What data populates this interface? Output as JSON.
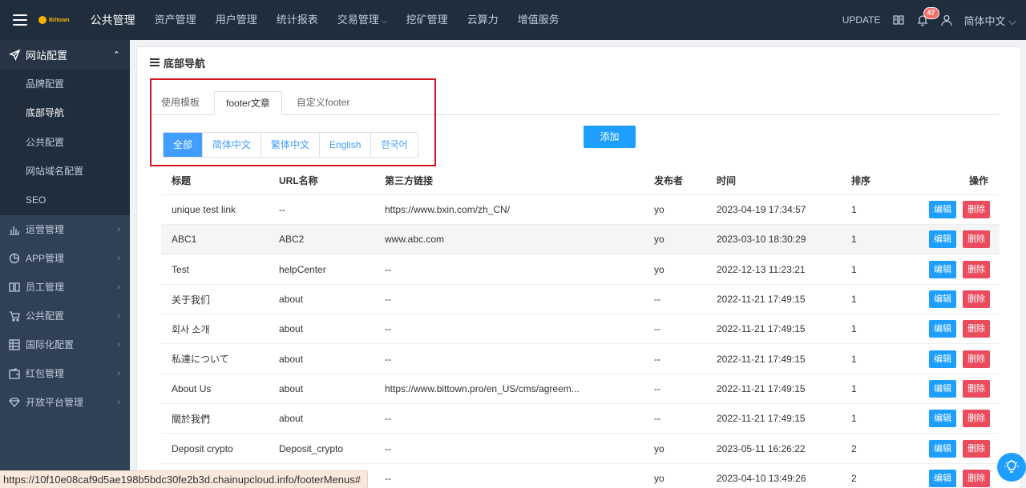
{
  "topbar": {
    "logo_text": "Bittown",
    "nav": [
      {
        "label": "公共管理",
        "active": true
      },
      {
        "label": "资产管理"
      },
      {
        "label": "用户管理"
      },
      {
        "label": "统计报表"
      },
      {
        "label": "交易管理",
        "has_dropdown": true
      },
      {
        "label": "挖矿管理"
      },
      {
        "label": "云算力"
      },
      {
        "label": "增值服务"
      }
    ],
    "update_label": "UPDATE",
    "notification_count": "47",
    "language": "简体中文"
  },
  "sidebar": {
    "open_group": {
      "label": "网站配置",
      "icon": "send-icon"
    },
    "sub_items": [
      {
        "label": "品牌配置"
      },
      {
        "label": "底部导航",
        "active": true
      },
      {
        "label": "公共配置"
      },
      {
        "label": "网站域名配置"
      },
      {
        "label": "SEO"
      }
    ],
    "groups": [
      {
        "label": "运营管理",
        "icon": "bar-chart-icon"
      },
      {
        "label": "APP管理",
        "icon": "pie-chart-icon"
      },
      {
        "label": "员工管理",
        "icon": "book-icon"
      },
      {
        "label": "公共配置",
        "icon": "cart-icon"
      },
      {
        "label": "国际化配置",
        "icon": "grid-icon"
      },
      {
        "label": "红包管理",
        "icon": "wallet-icon"
      },
      {
        "label": "开放平台管理",
        "icon": "diamond-icon"
      }
    ]
  },
  "main": {
    "title": "底部导航",
    "tabs": [
      {
        "label": "使用模板"
      },
      {
        "label": "footer文章",
        "active": true
      },
      {
        "label": "自定义footer"
      }
    ],
    "lang_filters": [
      {
        "label": "全部",
        "active": true
      },
      {
        "label": "简体中文"
      },
      {
        "label": "繁体中文"
      },
      {
        "label": "English"
      },
      {
        "label": "한국어"
      }
    ],
    "add_label": "添加",
    "table": {
      "headers": [
        "标题",
        "URL名称",
        "第三方链接",
        "发布者",
        "时间",
        "排序",
        "操作"
      ],
      "edit_label": "编辑",
      "delete_label": "删除",
      "rows": [
        {
          "title": "unique test link",
          "url": "--",
          "link": "https://www.bxin.com/zh_CN/",
          "publisher": "yo",
          "time": "2023-04-19 17:34:57",
          "sort": "1"
        },
        {
          "title": "ABC1",
          "url": "ABC2",
          "link": "www.abc.com",
          "publisher": "yo",
          "time": "2023-03-10 18:30:29",
          "sort": "1"
        },
        {
          "title": "Test",
          "url": "helpCenter",
          "link": "--",
          "publisher": "yo",
          "time": "2022-12-13 11:23:21",
          "sort": "1"
        },
        {
          "title": "关于我们",
          "url": "about",
          "link": "--",
          "publisher": "--",
          "time": "2022-11-21 17:49:15",
          "sort": "1"
        },
        {
          "title": "회사 소개",
          "url": "about",
          "link": "--",
          "publisher": "--",
          "time": "2022-11-21 17:49:15",
          "sort": "1"
        },
        {
          "title": "私達について",
          "url": "about",
          "link": "--",
          "publisher": "--",
          "time": "2022-11-21 17:49:15",
          "sort": "1"
        },
        {
          "title": "About Us",
          "url": "about",
          "link": "https://www.bittown.pro/en_US/cms/agreem...",
          "publisher": "--",
          "time": "2022-11-21 17:49:15",
          "sort": "1"
        },
        {
          "title": "關於我們",
          "url": "about",
          "link": "--",
          "publisher": "--",
          "time": "2022-11-21 17:49:15",
          "sort": "1"
        },
        {
          "title": "Deposit crypto",
          "url": "Deposit_crypto",
          "link": "--",
          "publisher": "yo",
          "time": "2023-05-11 16:26:22",
          "sort": "2"
        },
        {
          "title": "",
          "url": "",
          "link": "--",
          "publisher": "yo",
          "time": "2023-04-10 13:49:26",
          "sort": "2"
        }
      ]
    }
  },
  "statusbar": {
    "url": "https://10f10e08caf9d5ae198b5bdc30fe2b3d.chainupcloud.info/footerMenus#"
  }
}
